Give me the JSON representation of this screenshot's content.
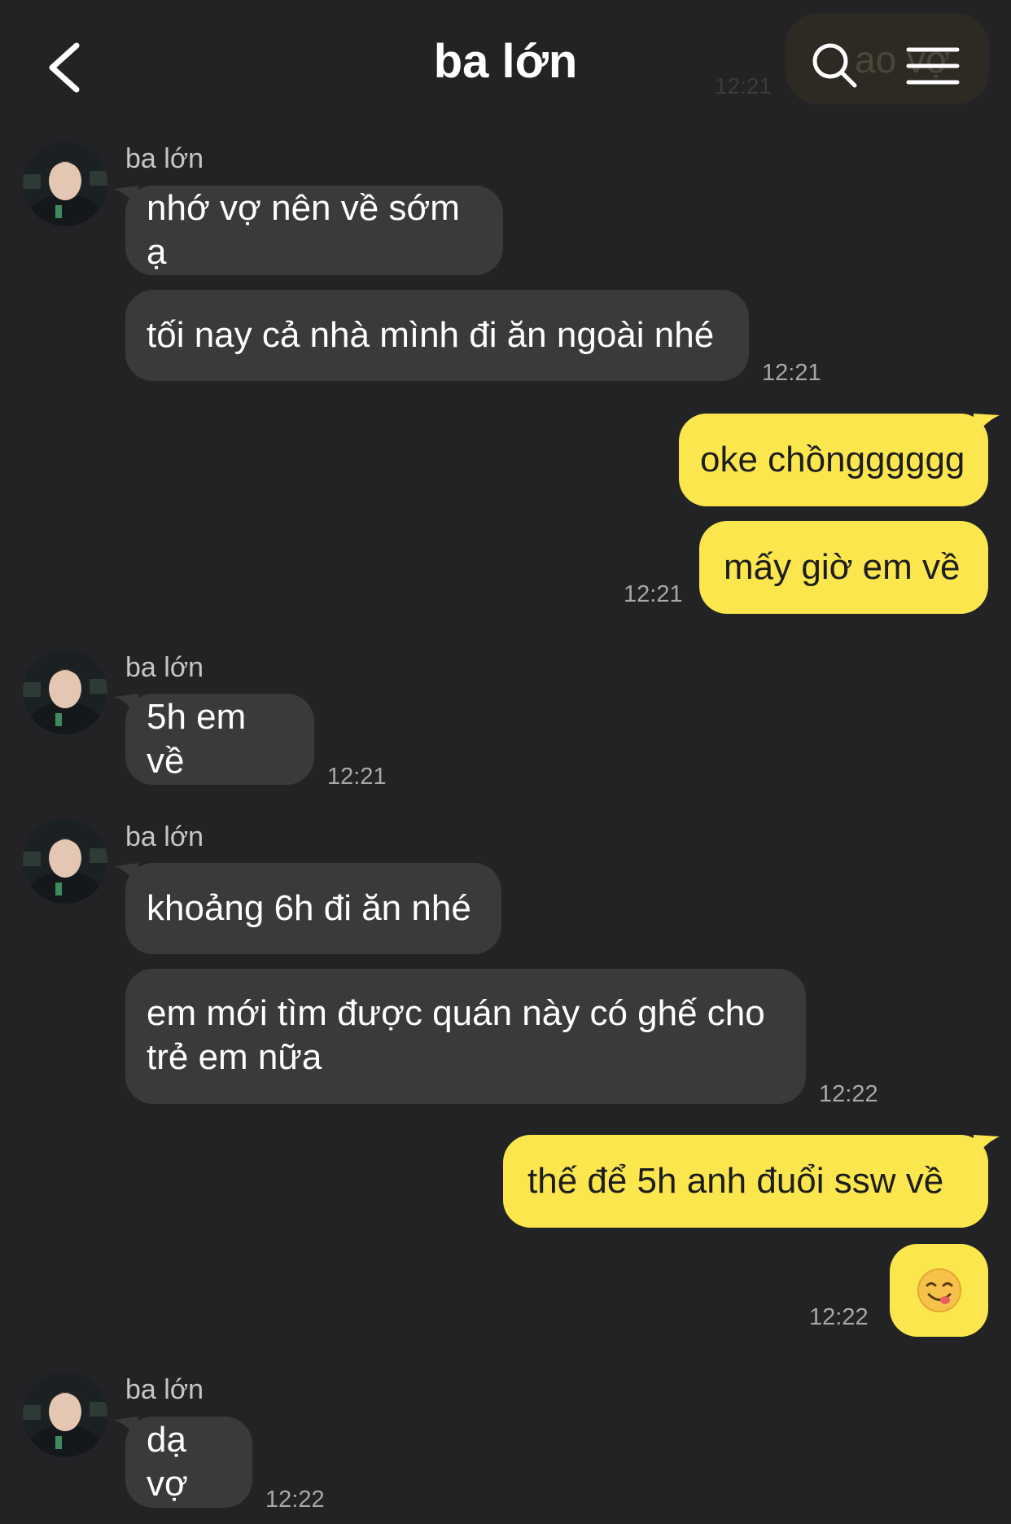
{
  "header": {
    "title": "ba lớn",
    "ghost_time": "12:21",
    "ghost_text": "ao vợ"
  },
  "messages": {
    "sender_name": "ba lớn",
    "g1_m1": "nhớ vợ nên về sớm ạ",
    "g1_m2": "tối nay cả nhà mình đi ăn ngoài nhé",
    "g1_time": "12:21",
    "g2_m1": "oke chồngggggg",
    "g2_m2": "mấy giờ em về",
    "g2_time": "12:21",
    "g3_m1": "5h em về",
    "g3_time": "12:21",
    "g4_m1": "khoảng 6h đi ăn nhé",
    "g4_m2_line1": "em mới tìm được quán này có ghế cho",
    "g4_m2_line2": "trẻ em nữa",
    "g4_time": "12:22",
    "g5_m1": "thế để 5h anh đuổi ssw về",
    "g5_emoji": "yum-face-emoji",
    "g5_time": "12:22",
    "g6_m1": "dạ vợ",
    "g6_time": "12:22"
  },
  "colors": {
    "background": "#232326",
    "incoming_bubble": "#3a3a3d",
    "outgoing_bubble": "#fbe64d",
    "timestamp": "#a8a8a8"
  },
  "icons": [
    "back-icon",
    "search-icon",
    "menu-icon"
  ]
}
